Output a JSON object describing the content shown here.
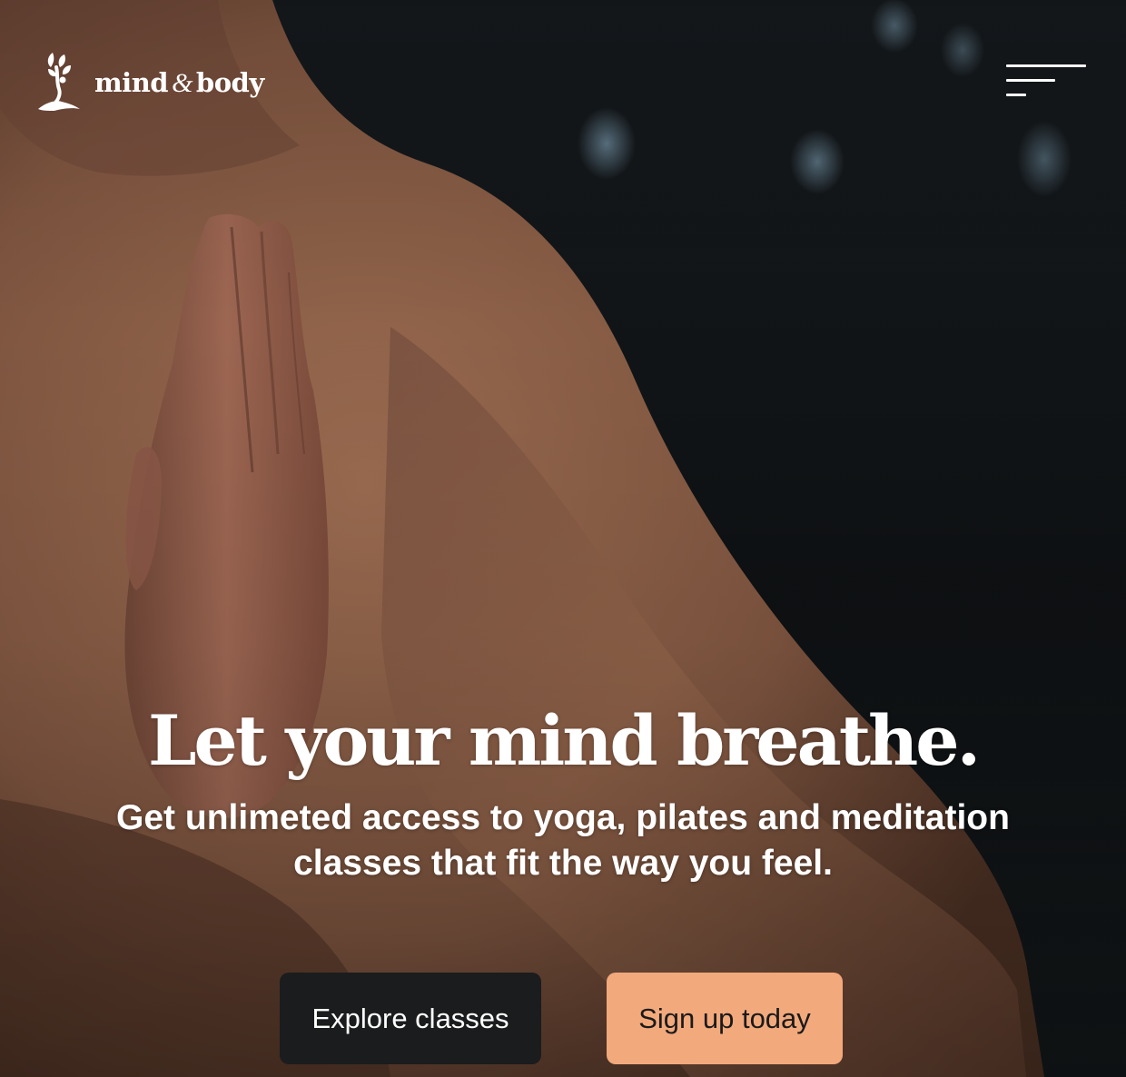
{
  "header": {
    "brand": {
      "word_mind": "mind",
      "ampersand": "&",
      "word_body": "body"
    },
    "menu_icon": "hamburger-menu-icon"
  },
  "hero": {
    "headline": "Let your mind breathe.",
    "subheadline_line1": "Get unlimeted access to yoga, pilates and meditation",
    "subheadline_line2": "classes that fit the way you feel.",
    "background_image": "person in prayer pose with palms pressed together, dark gym background"
  },
  "actions": {
    "explore_label": "Explore classes",
    "signup_label": "Sign up today"
  },
  "colors": {
    "accent": "#f2a97c",
    "dark_button": "#1b1c1d",
    "text": "#ffffff"
  }
}
